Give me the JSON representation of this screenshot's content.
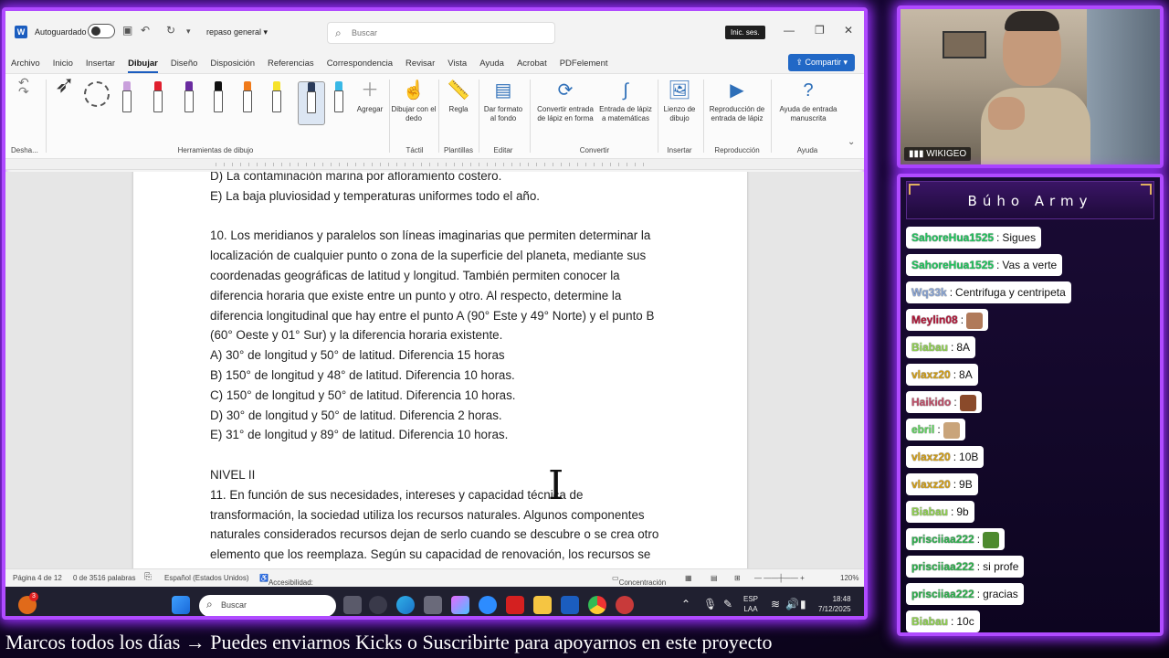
{
  "word": {
    "title": {
      "autosave_label": "Autoguardado",
      "doc_name": "repaso general",
      "search_placeholder": "Buscar",
      "signin_label": "Inic. ses."
    },
    "menu": [
      "Archivo",
      "Inicio",
      "Insertar",
      "Dibujar",
      "Diseño",
      "Disposición",
      "Referencias",
      "Correspondencia",
      "Revisar",
      "Vista",
      "Ayuda",
      "Acrobat",
      "PDFelement"
    ],
    "active_menu": "Dibujar",
    "share_label": "Compartir",
    "ribbon": {
      "undo_label": "Desha...",
      "tools_group": "Herramientas de dibujo",
      "add_label": "Agregar",
      "draw_finger_label": "Dibujar con el dedo",
      "tactil_group": "Táctil",
      "ruler_label": "Regla",
      "templates_group": "Plantillas",
      "format_bg_label": "Dar formato al fondo",
      "edit_group": "Editar",
      "convert_shape_label": "Convertir entrada de lápiz en forma",
      "math_label": "Entrada de lápiz a matemáticas",
      "convert_group": "Convertir",
      "canvas_label": "Lienzo de dibujo",
      "insert_group": "Insertar",
      "replay_label": "Reproducción de entrada de lápiz",
      "replay_group": "Reproducción",
      "handwriting_label": "Ayuda de entrada manuscrita",
      "help_group": "Ayuda"
    },
    "document_lines": [
      "D) La contaminación marina por afloramiento costero.",
      "E) La baja pluviosidad y temperaturas uniformes todo el año.",
      "",
      "10. Los meridianos y paralelos son líneas imaginarias que permiten determinar la",
      "localización de cualquier punto o zona de la superficie del planeta, mediante sus",
      "coordenadas geográficas de latitud y longitud. También permiten conocer la",
      "diferencia horaria que existe entre un punto y otro. Al respecto, determine la",
      "diferencia longitudinal que hay entre el punto A (90° Este y 49° Norte) y el punto B",
      "(60° Oeste y 01° Sur) y la diferencia horaria existente.",
      "A) 30° de longitud y 50° de latitud. Diferencia 15 horas",
      "B) 150° de longitud y 48° de latitud. Diferencia 10 horas.",
      "C) 150° de longitud y 50° de latitud. Diferencia 10 horas.",
      "D) 30° de longitud y 50° de latitud. Diferencia 2 horas.",
      "E) 31° de longitud y 89° de latitud. Diferencia 10 horas.",
      "",
      "NIVEL II",
      "11. En función de sus necesidades, intereses y capacidad técnica de",
      "transformación, la sociedad utiliza los recursos naturales. Algunos componentes",
      "naturales considerados recursos dejan de serlo cuando se descubre o se crea otro",
      "elemento que los reemplaza. Según su capacidad de renovación, los recursos se"
    ],
    "status": {
      "page": "Página 4 de 12",
      "words": "0 de 3516 palabras",
      "language": "Español (Estados Unidos)",
      "accessibility": "Accesibilidad: es necesario investigar",
      "focus": "Concentración",
      "zoom": "120%"
    },
    "taskbar": {
      "search_placeholder": "Buscar",
      "lang_top": "ESP",
      "lang_bottom": "LAA",
      "time": "18:48",
      "date": "7/12/2025",
      "notif_badge": "3"
    }
  },
  "cam": {
    "label": "WIKIGEO"
  },
  "chat": {
    "title": "Búho Army",
    "messages": [
      {
        "user": "SahoreHua1525",
        "text": "Sigues",
        "color": "#22c55e"
      },
      {
        "user": "SahoreHua1525",
        "text": "Vas a verte",
        "color": "#22c55e"
      },
      {
        "user": "Wq33k",
        "text": "Centrifuga y centripeta",
        "color": "#8ba6d6"
      },
      {
        "user": "Meylin08",
        "text": "",
        "color": "#b4183a",
        "emote": "#b07a5a"
      },
      {
        "user": "Biabau",
        "text": "8A",
        "color": "#8fd14f"
      },
      {
        "user": "vlaxz20",
        "text": "8A",
        "color": "#d4a017"
      },
      {
        "user": "Haikido",
        "text": "",
        "color": "#c0506a",
        "emote": "#8a4a2a"
      },
      {
        "user": "ebril",
        "text": "",
        "color": "#5fd35f",
        "emote": "#c9a47a"
      },
      {
        "user": "vlaxz20",
        "text": "10B",
        "color": "#d4a017"
      },
      {
        "user": "vlaxz20",
        "text": "9B",
        "color": "#d4a017"
      },
      {
        "user": "Biabau",
        "text": "9b",
        "color": "#8fd14f"
      },
      {
        "user": "prisciiaa222",
        "text": "",
        "color": "#2fb34f",
        "emote": "#4d8a2e"
      },
      {
        "user": "prisciiaa222",
        "text": "si profe",
        "color": "#2fb34f"
      },
      {
        "user": "prisciiaa222",
        "text": "gracias",
        "color": "#2fb34f"
      },
      {
        "user": "Biabau",
        "text": "10c",
        "color": "#8fd14f"
      }
    ]
  },
  "ticker": "Marcos todos los días  →  Puedes enviarnos Kicks o Suscribirte para apoyarnos en este proyecto"
}
